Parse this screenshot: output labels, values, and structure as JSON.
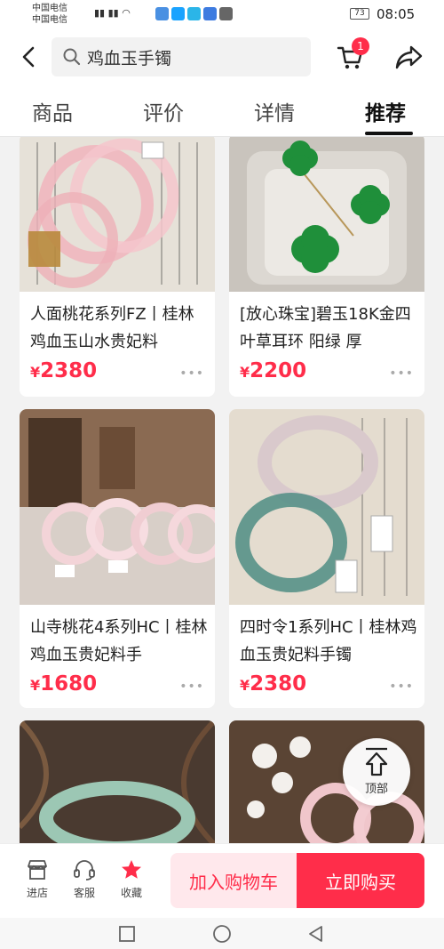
{
  "status_bar": {
    "carrier_1": "中国电信",
    "carrier_2": "中国电信",
    "battery": "73",
    "time": "08:05"
  },
  "header": {
    "search_text": "鸡血玉手镯",
    "cart_badge": "1"
  },
  "tabs": [
    {
      "label": "商品",
      "active": false
    },
    {
      "label": "评价",
      "active": false
    },
    {
      "label": "详情",
      "active": false
    },
    {
      "label": "推荐",
      "active": true
    }
  ],
  "products": [
    {
      "title": "人面桃花系列FZ丨桂林鸡血玉山水贵妃料",
      "currency": "¥",
      "price": "2380"
    },
    {
      "title": "[放心珠宝]碧玉18K金四叶草耳环 阳绿 厚",
      "currency": "¥",
      "price": "2200"
    },
    {
      "title": "山寺桃花4系列HC丨桂林鸡血玉贵妃料手",
      "currency": "¥",
      "price": "1680"
    },
    {
      "title": "四时令1系列HC丨桂林鸡血玉贵妃料手镯",
      "currency": "¥",
      "price": "2380"
    }
  ],
  "more_dots": "•••",
  "to_top_label": "顶部",
  "bottom_bar": {
    "shop_label": "进店",
    "service_label": "客服",
    "favorite_label": "收藏",
    "add_cart_label": "加入购物车",
    "buy_now_label": "立即购买"
  },
  "colors": {
    "accent": "#ff2d4a",
    "accent_light": "#ffe8ec"
  }
}
